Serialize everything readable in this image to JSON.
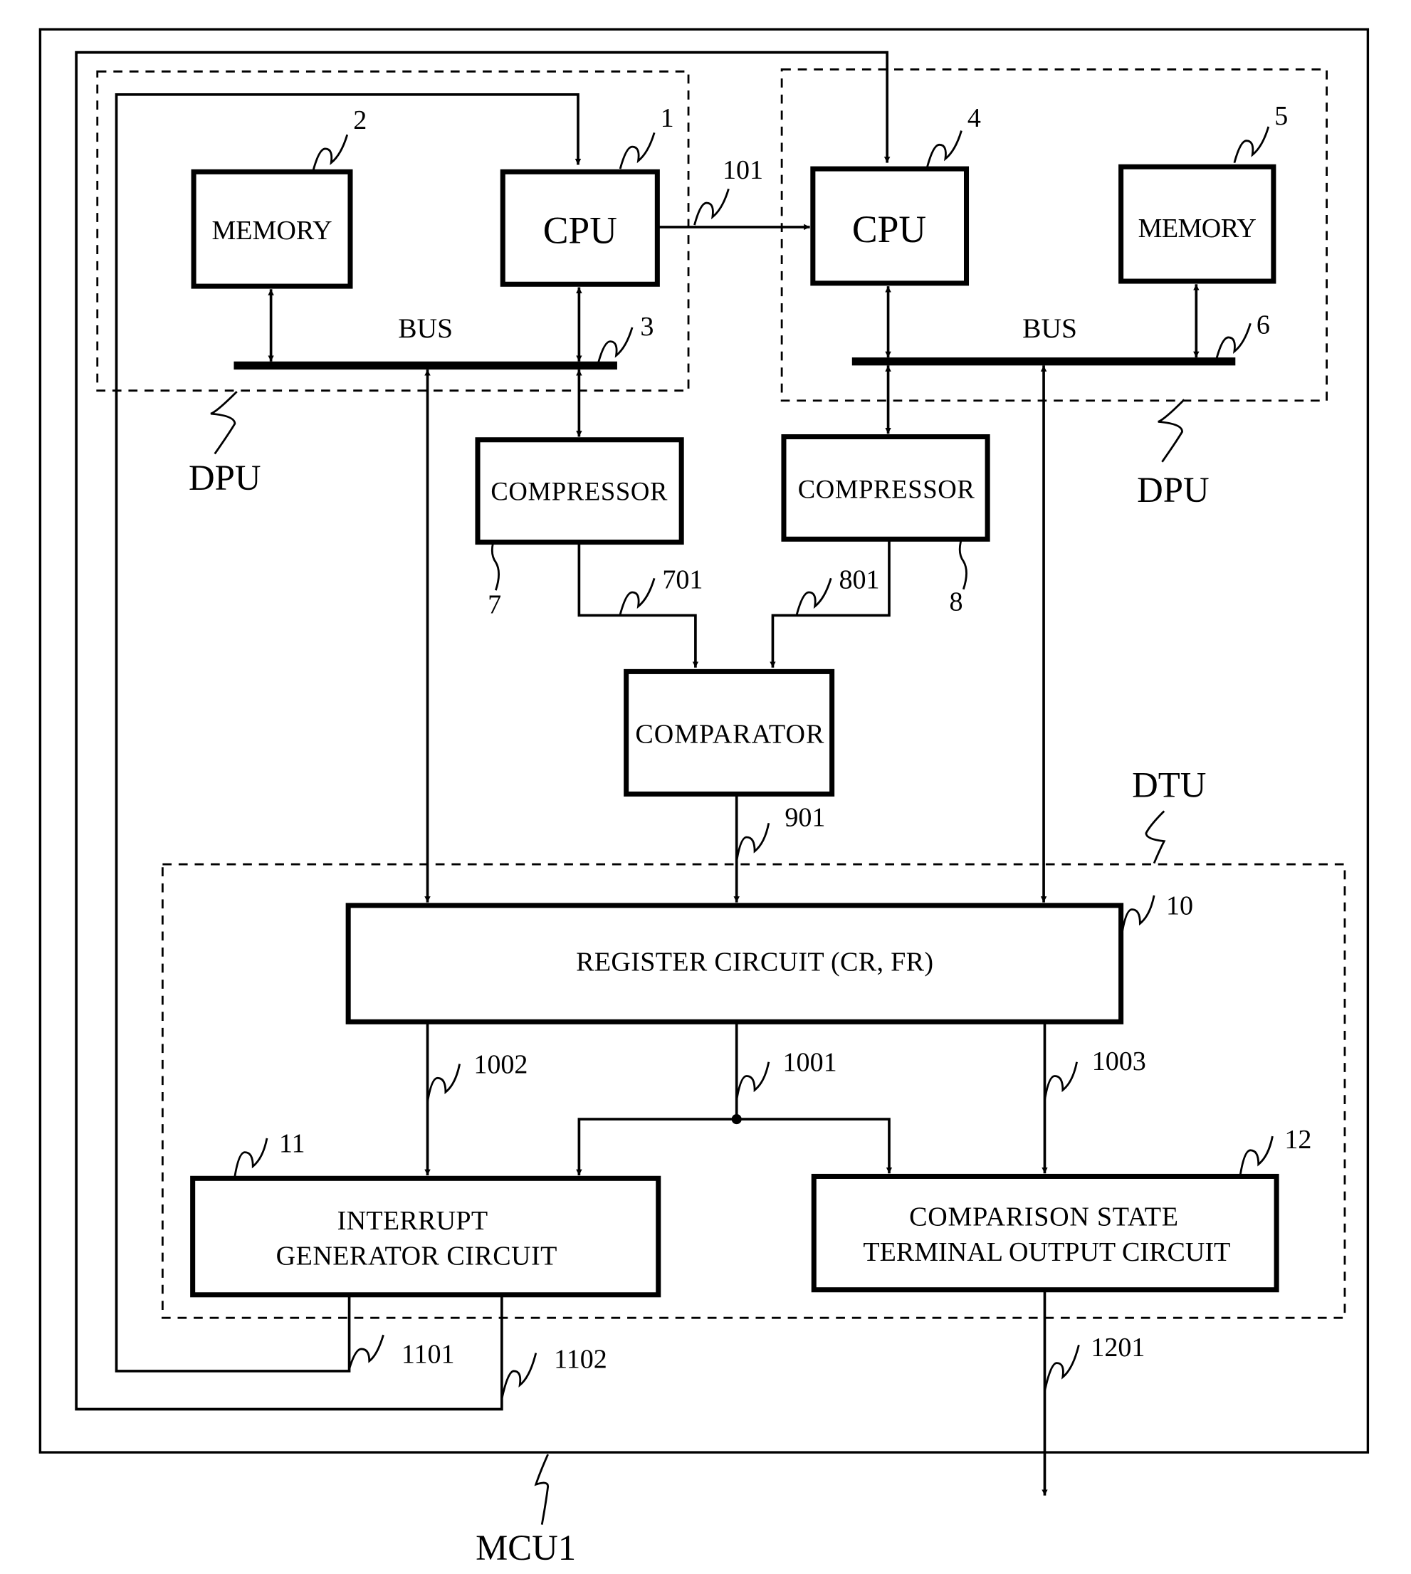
{
  "diagram": {
    "outer_label": "MCU1",
    "groups": {
      "dpu_left": "DPU",
      "dpu_right": "DPU",
      "dtu": "DTU"
    },
    "blocks": {
      "cpu1": {
        "label": "CPU",
        "ref": "1"
      },
      "memory2": {
        "label": "MEMORY",
        "ref": "2"
      },
      "bus3": {
        "label": "BUS",
        "ref": "3"
      },
      "cpu4": {
        "label": "CPU",
        "ref": "4"
      },
      "memory5": {
        "label": "MEMORY",
        "ref": "5"
      },
      "bus6": {
        "label": "BUS",
        "ref": "6"
      },
      "compressor7": {
        "label": "COMPRESSOR",
        "ref": "7"
      },
      "compressor8": {
        "label": "COMPRESSOR",
        "ref": "8"
      },
      "comparator": {
        "label": "COMPARATOR"
      },
      "register10": {
        "label": "REGISTER CIRCUIT (CR, FR)",
        "ref": "10"
      },
      "interrupt11": {
        "label_line1": "INTERRUPT",
        "label_line2": "GENERATOR CIRCUIT",
        "ref": "11"
      },
      "output12": {
        "label_line1": "COMPARISON STATE",
        "label_line2": "TERMINAL OUTPUT CIRCUIT",
        "ref": "12"
      }
    },
    "signals": {
      "s101": "101",
      "s701": "701",
      "s801": "801",
      "s901": "901",
      "s1001": "1001",
      "s1002": "1002",
      "s1003": "1003",
      "s1101": "1101",
      "s1102": "1102",
      "s1201": "1201"
    }
  }
}
